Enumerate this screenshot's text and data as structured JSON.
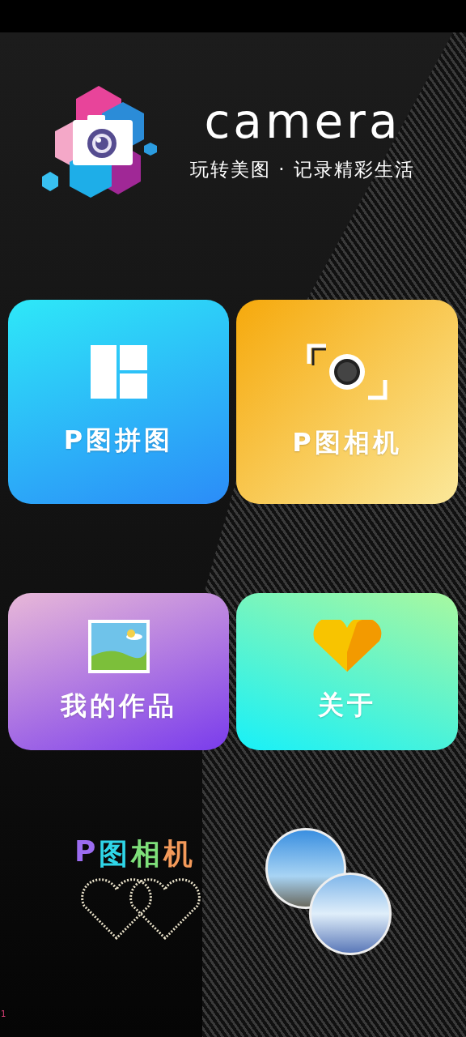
{
  "header": {
    "title": "camera",
    "subtitle": "玩转美图 · 记录精彩生活"
  },
  "tiles": [
    {
      "kind": "collage",
      "label": "P图拼图",
      "color": "#22a8f5"
    },
    {
      "kind": "camera",
      "label": "P图相机",
      "color": "#f7b224"
    },
    {
      "kind": "works",
      "label": "我的作品",
      "color": "#8b4be8"
    },
    {
      "kind": "about",
      "label": "关于",
      "color": "#2ff0e0"
    }
  ],
  "decor_title": [
    {
      "text": "P",
      "color": "#9b6cf0"
    },
    {
      "text": "图",
      "color": "#2fd6e8"
    },
    {
      "text": "相",
      "color": "#7ee07a"
    },
    {
      "text": "机",
      "color": "#f49a5a"
    }
  ],
  "corner_mark": "1"
}
